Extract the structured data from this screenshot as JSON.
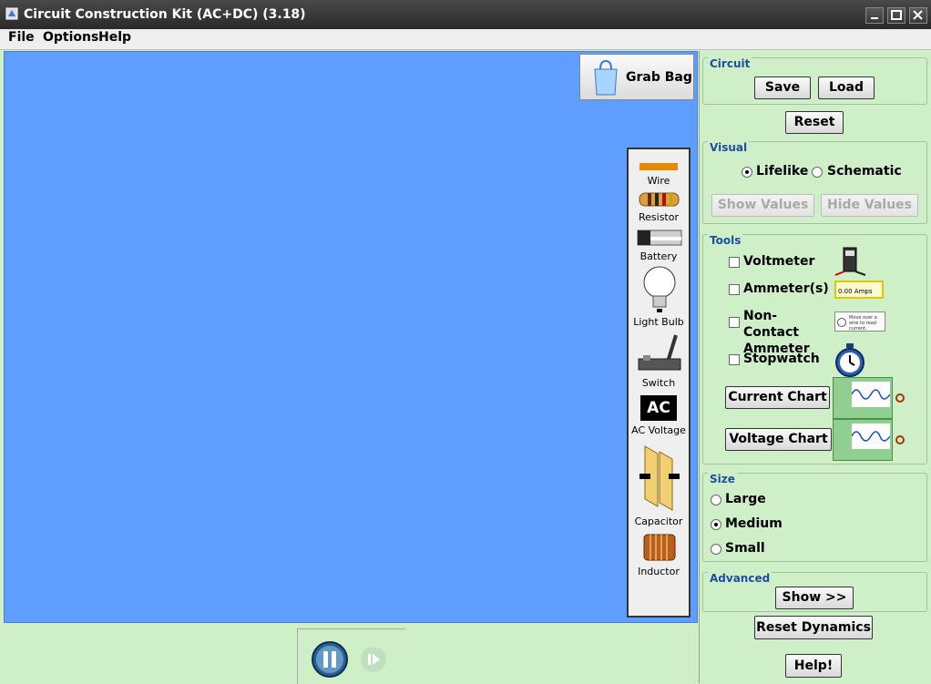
{
  "window": {
    "title": "Circuit Construction Kit (AC+DC) (3.18)"
  },
  "menu": {
    "file": "File",
    "options": "Options",
    "help": "Help"
  },
  "grab_bag": {
    "label": "Grab Bag"
  },
  "toolbox": {
    "wire": "Wire",
    "resistor": "Resistor",
    "battery": "Battery",
    "light_bulb": "Light Bulb",
    "switch": "Switch",
    "ac_voltage": "AC Voltage",
    "ac_icon_text": "AC",
    "capacitor": "Capacitor",
    "inductor": "Inductor"
  },
  "panel": {
    "circuit": {
      "title": "Circuit",
      "save": "Save",
      "load": "Load",
      "reset": "Reset"
    },
    "visual": {
      "title": "Visual",
      "lifelike": "Lifelike",
      "schematic": "Schematic",
      "selected": "Lifelike",
      "show_values": "Show Values",
      "hide_values": "Hide Values"
    },
    "tools": {
      "title": "Tools",
      "voltmeter": "Voltmeter",
      "ammeter": "Ammeter(s)",
      "ammeter_readout": "0.00 Amps",
      "noncontact": "Non-Contact Ammeter",
      "noncontact_readout": "Move over a wire to read current.",
      "stopwatch": "Stopwatch",
      "current_chart": "Current Chart",
      "voltage_chart": "Voltage Chart"
    },
    "size": {
      "title": "Size",
      "large": "Large",
      "medium": "Medium",
      "small": "Small",
      "selected": "Medium"
    },
    "advanced": {
      "title": "Advanced",
      "show": "Show >>"
    },
    "reset_dynamics": "Reset Dynamics",
    "help": "Help!"
  },
  "colors": {
    "canvas": "#5f9dff",
    "panel": "#cfefc8",
    "group_title": "#1f4ea1"
  }
}
